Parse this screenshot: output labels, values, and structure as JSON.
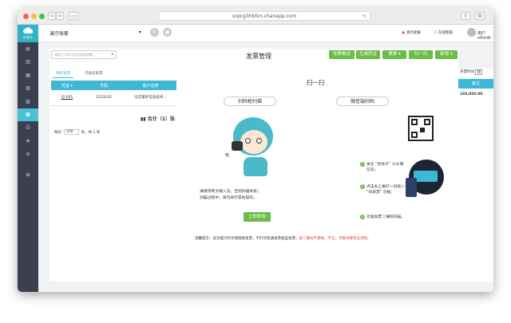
{
  "browser": {
    "url": "urpcg3hbfvn.chanapp.com",
    "nav_back": "<",
    "nav_fwd": ">",
    "refresh_glyph": "↻"
  },
  "app": {
    "logo_text": "好会计",
    "company": "演示账套",
    "user": "用户n6VrAr",
    "top_links": [
      "演示套餐",
      "在线客服"
    ]
  },
  "sidebar": {
    "icons": [
      "book-icon",
      "voucher-icon",
      "chart-icon",
      "report-icon",
      "invoice-icon",
      "archive-icon",
      "print-icon",
      "tax-icon",
      "settings-icon",
      "gift-icon"
    ],
    "active_index": 5
  },
  "page": {
    "title": "发票管理",
    "search_placeholder": "请输入号码/名称/金额/税额..."
  },
  "toolbar": {
    "buttons": [
      "发票推送",
      "生成凭证",
      "票票",
      "扫一扫",
      "新增"
    ]
  },
  "tabs": [
    "销售发票",
    "可抵扣发票"
  ],
  "table": {
    "headers": [
      "凭证",
      "号码",
      "客户名称"
    ],
    "rows": [
      [
        "记-001",
        "1223245",
        "北京紫叶信息技术..."
      ]
    ],
    "sum_label": "合计（1）张",
    "pager_prefix": "每页",
    "page_size": "200",
    "pager_suffix": "条，共 1 条"
  },
  "right_panel": {
    "time_label": "开票时间",
    "col_header": "备注",
    "amount": "193,050.00"
  },
  "scan_modal": {
    "title": "扫一扫",
    "left": {
      "heading": "扫码枪扫描",
      "instr": [
        "请保持英文输入法，否则扫描失败；",
        "扫描过程中，请勿进行其他操作。"
      ],
      "button": "立即体验",
      "hi": "哈"
    },
    "right": {
      "heading": "微信端扫码",
      "steps": [
        {
          "n": "1",
          "text": "关注 “好会计” 公众微信号；"
        },
        {
          "n": "2",
          "text": "点击右上角打一扫进入 “扫发票” 功能；"
        },
        {
          "n": "3",
          "text": "对准发票二维码扫描。"
        }
      ]
    },
    "tip_prefix": "温馨提示：该功能只针对增值税发票，不针对普通发票类型发票；",
    "tip_red": "如二维码不清晰、不全，可能导致无法识别。"
  }
}
